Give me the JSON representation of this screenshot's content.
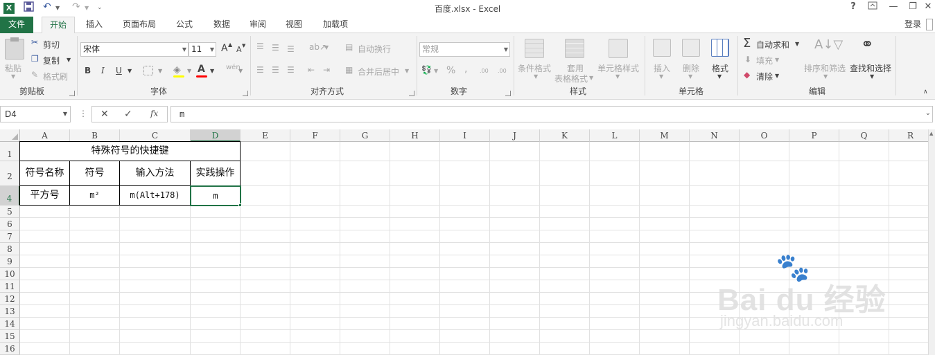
{
  "window": {
    "title": "百度.xlsx - Excel",
    "help_label": "?",
    "signin_label": "登录"
  },
  "tabs": [
    "文件",
    "开始",
    "插入",
    "页面布局",
    "公式",
    "数据",
    "审阅",
    "视图",
    "加载项"
  ],
  "ribbon": {
    "clipboard": {
      "label": "剪贴板",
      "paste": "粘贴",
      "cut": "剪切",
      "copy": "复制",
      "format_painter": "格式刷"
    },
    "font": {
      "label": "字体",
      "font_name": "宋体",
      "font_size": "11",
      "bold": "B",
      "italic": "I",
      "underline": "U",
      "grow": "A",
      "shrink": "A",
      "color_a": "A",
      "phonetic": "wén"
    },
    "alignment": {
      "label": "对齐方式",
      "wrap_text": "自动换行",
      "merge_center": "合并后居中"
    },
    "number": {
      "label": "数字",
      "format": "常规",
      "percent": "%",
      "comma": ",",
      "inc_dec": ".00",
      "dec_dec": ".00"
    },
    "styles": {
      "label": "样式",
      "conditional": "条件格式",
      "table_format_1": "套用",
      "table_format_2": "表格格式",
      "cell_styles": "单元格样式"
    },
    "cells": {
      "label": "单元格",
      "insert": "插入",
      "delete": "删除",
      "format": "格式"
    },
    "editing": {
      "label": "编辑",
      "autosum": "自动求和",
      "fill": "填充",
      "clear": "清除",
      "sort_filter": "排序和筛选",
      "find_select": "查找和选择"
    }
  },
  "formula_bar": {
    "name_box": "D4",
    "cancel": "✕",
    "enter": "✓",
    "fx": "fx",
    "content": "m"
  },
  "columns": [
    "A",
    "B",
    "C",
    "D",
    "E",
    "F",
    "G",
    "H",
    "I",
    "J",
    "K",
    "L",
    "M",
    "N",
    "O",
    "P",
    "Q",
    "R"
  ],
  "rows": [
    "1",
    "2",
    "3",
    "4",
    "5",
    "6",
    "7",
    "8",
    "9",
    "10",
    "11",
    "12",
    "13",
    "14",
    "15",
    "16"
  ],
  "selected_cell": "D4",
  "table": {
    "title": "特殊符号的快捷键",
    "headers": [
      "符号名称",
      "符号",
      "输入方法",
      "实践操作"
    ],
    "row": [
      "平方号",
      "m²",
      "m(Alt+178)",
      "m"
    ]
  },
  "watermark": {
    "line1": "Bai du 经验",
    "line2": "jingyan.baidu.com"
  },
  "colors": {
    "excel_green": "#217346",
    "ribbon_bg": "#f3f3f3",
    "grid_line": "#e1e1e1"
  }
}
